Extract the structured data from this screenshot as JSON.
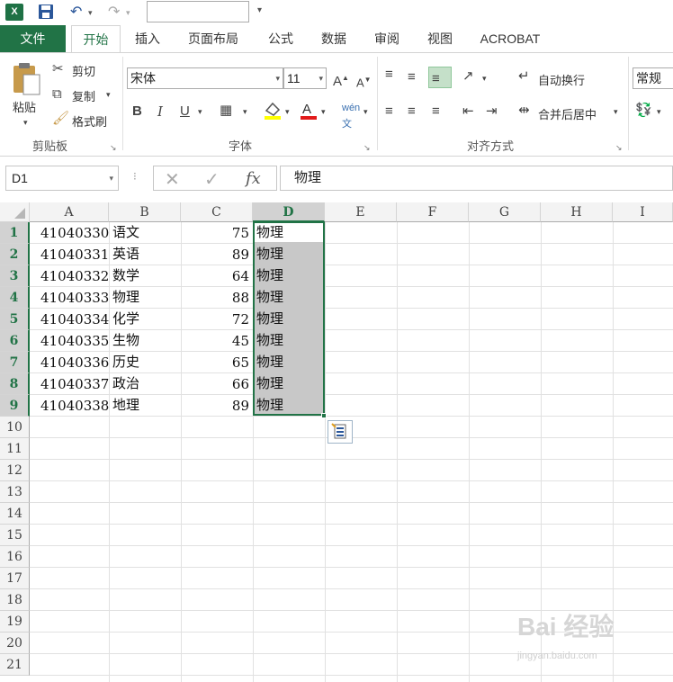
{
  "qat": {
    "logo": "X",
    "undo": "↶",
    "redo": "↷",
    "save": "💾"
  },
  "tabs": [
    "文件",
    "开始",
    "插入",
    "页面布局",
    "公式",
    "数据",
    "审阅",
    "视图",
    "ACROBAT"
  ],
  "ribbon": {
    "clipboard": {
      "paste": "粘贴",
      "cut": "剪切",
      "copy": "复制",
      "format_painter": "格式刷",
      "label": "剪贴板"
    },
    "font": {
      "name": "宋体",
      "size": "11",
      "bold": "B",
      "italic": "I",
      "underline": "U",
      "label": "字体"
    },
    "alignment": {
      "wrap_text": "自动换行",
      "merge_center": "合并后居中",
      "label": "对齐方式"
    },
    "number": {
      "format": "常规"
    }
  },
  "formula_bar": {
    "name_box": "D1",
    "content": "物理",
    "fx": "fx"
  },
  "columns": [
    "A",
    "B",
    "C",
    "D",
    "E",
    "F",
    "G",
    "H",
    "I"
  ],
  "rows": [
    "1",
    "2",
    "3",
    "4",
    "5",
    "6",
    "7",
    "8",
    "9",
    "10",
    "11",
    "12",
    "13",
    "14",
    "15",
    "16",
    "17",
    "18",
    "19",
    "20",
    "21"
  ],
  "table": [
    {
      "a": "41040330",
      "b": "语文",
      "c": "75",
      "d": "物理"
    },
    {
      "a": "41040331",
      "b": "英语",
      "c": "89",
      "d": "物理"
    },
    {
      "a": "41040332",
      "b": "数学",
      "c": "64",
      "d": "物理"
    },
    {
      "a": "41040333",
      "b": "物理",
      "c": "88",
      "d": "物理"
    },
    {
      "a": "41040334",
      "b": "化学",
      "c": "72",
      "d": "物理"
    },
    {
      "a": "41040335",
      "b": "生物",
      "c": "45",
      "d": "物理"
    },
    {
      "a": "41040336",
      "b": "历史",
      "c": "65",
      "d": "物理"
    },
    {
      "a": "41040337",
      "b": "政治",
      "c": "66",
      "d": "物理"
    },
    {
      "a": "41040338",
      "b": "地理",
      "c": "89",
      "d": "物理"
    }
  ],
  "watermark": {
    "brand": "Bai 经验",
    "url": "jingyan.baidu.com"
  },
  "colors": {
    "accent": "#217346",
    "selection": "#c8c8c8"
  }
}
